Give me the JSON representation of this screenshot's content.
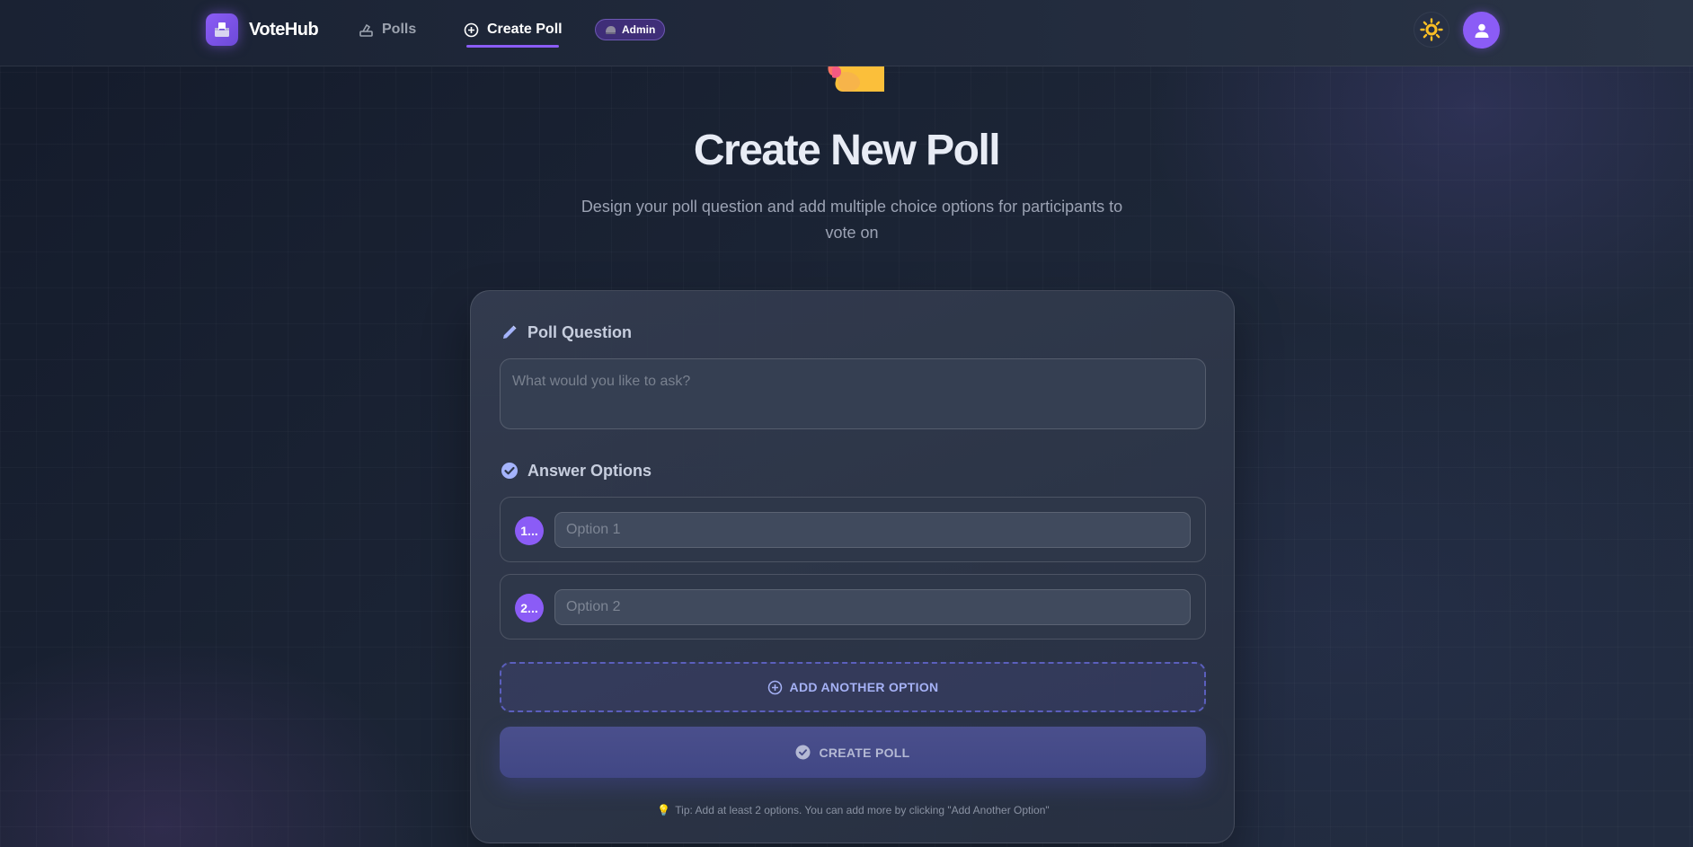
{
  "navbar": {
    "brand": "VoteHub",
    "links": [
      {
        "label": "Polls",
        "icon": "ballot-hand-icon"
      },
      {
        "label": "Create Poll",
        "icon": "plus-circle-icon",
        "active": true
      }
    ],
    "admin_badge": "Admin",
    "theme_icon": "sun-icon",
    "avatar_icon": "user-icon"
  },
  "hero": {
    "title": "Create New Poll",
    "subtitle": "Design your poll question and add multiple choice options for participants to vote on"
  },
  "form": {
    "question_label": "Poll Question",
    "question_placeholder": "What would you like to ask?",
    "options_label": "Answer Options",
    "options": [
      {
        "number": "1...",
        "placeholder": "Option 1"
      },
      {
        "number": "2...",
        "placeholder": "Option 2"
      }
    ],
    "add_option_label": "ADD ANOTHER OPTION",
    "create_label": "CREATE POLL",
    "tip": "Tip: Add at least 2 options. You can add more by clicking \"Add Another Option\""
  },
  "colors": {
    "accent": "#8b5cf6",
    "background": "#1a2233",
    "card": "#343d50",
    "dashed_border": "#5b5fbd",
    "sun": "#fbbf24"
  }
}
